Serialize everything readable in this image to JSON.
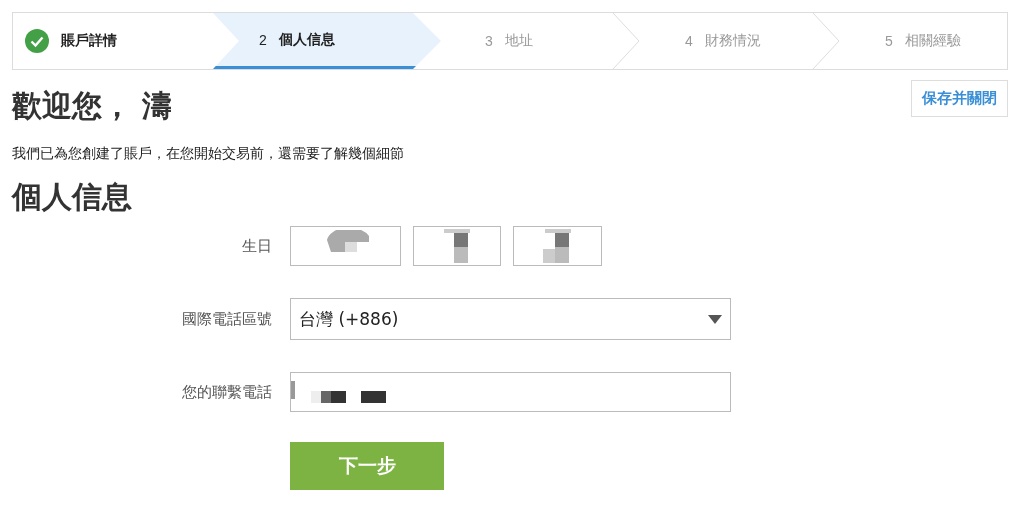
{
  "steps": [
    {
      "label": "賬戶詳情",
      "completed": true,
      "selected": false
    },
    {
      "number": "2",
      "label": "個人信息",
      "completed": false,
      "selected": true
    },
    {
      "number": "3",
      "label": "地址",
      "completed": false,
      "selected": false
    },
    {
      "number": "4",
      "label": "財務情況",
      "completed": false,
      "selected": false
    },
    {
      "number": "5",
      "label": "相關經驗",
      "completed": false,
      "selected": false
    }
  ],
  "save_button": "保存并關閉",
  "greeting": "歡迎您， 濤",
  "intro": "我們已為您創建了賬戶，在您開始交易前，還需要了解幾個細節",
  "section_title": "個人信息",
  "form": {
    "birthday": {
      "label": "生日",
      "fields": [
        {
          "kind": "redacted"
        },
        {
          "kind": "redacted"
        },
        {
          "kind": "redacted"
        }
      ]
    },
    "country_code": {
      "label": "國際電話區號",
      "value": "台灣 (+886)"
    },
    "phone": {
      "label": "您的聯繫電話",
      "kind": "redacted"
    }
  },
  "next_button": "下一步"
}
